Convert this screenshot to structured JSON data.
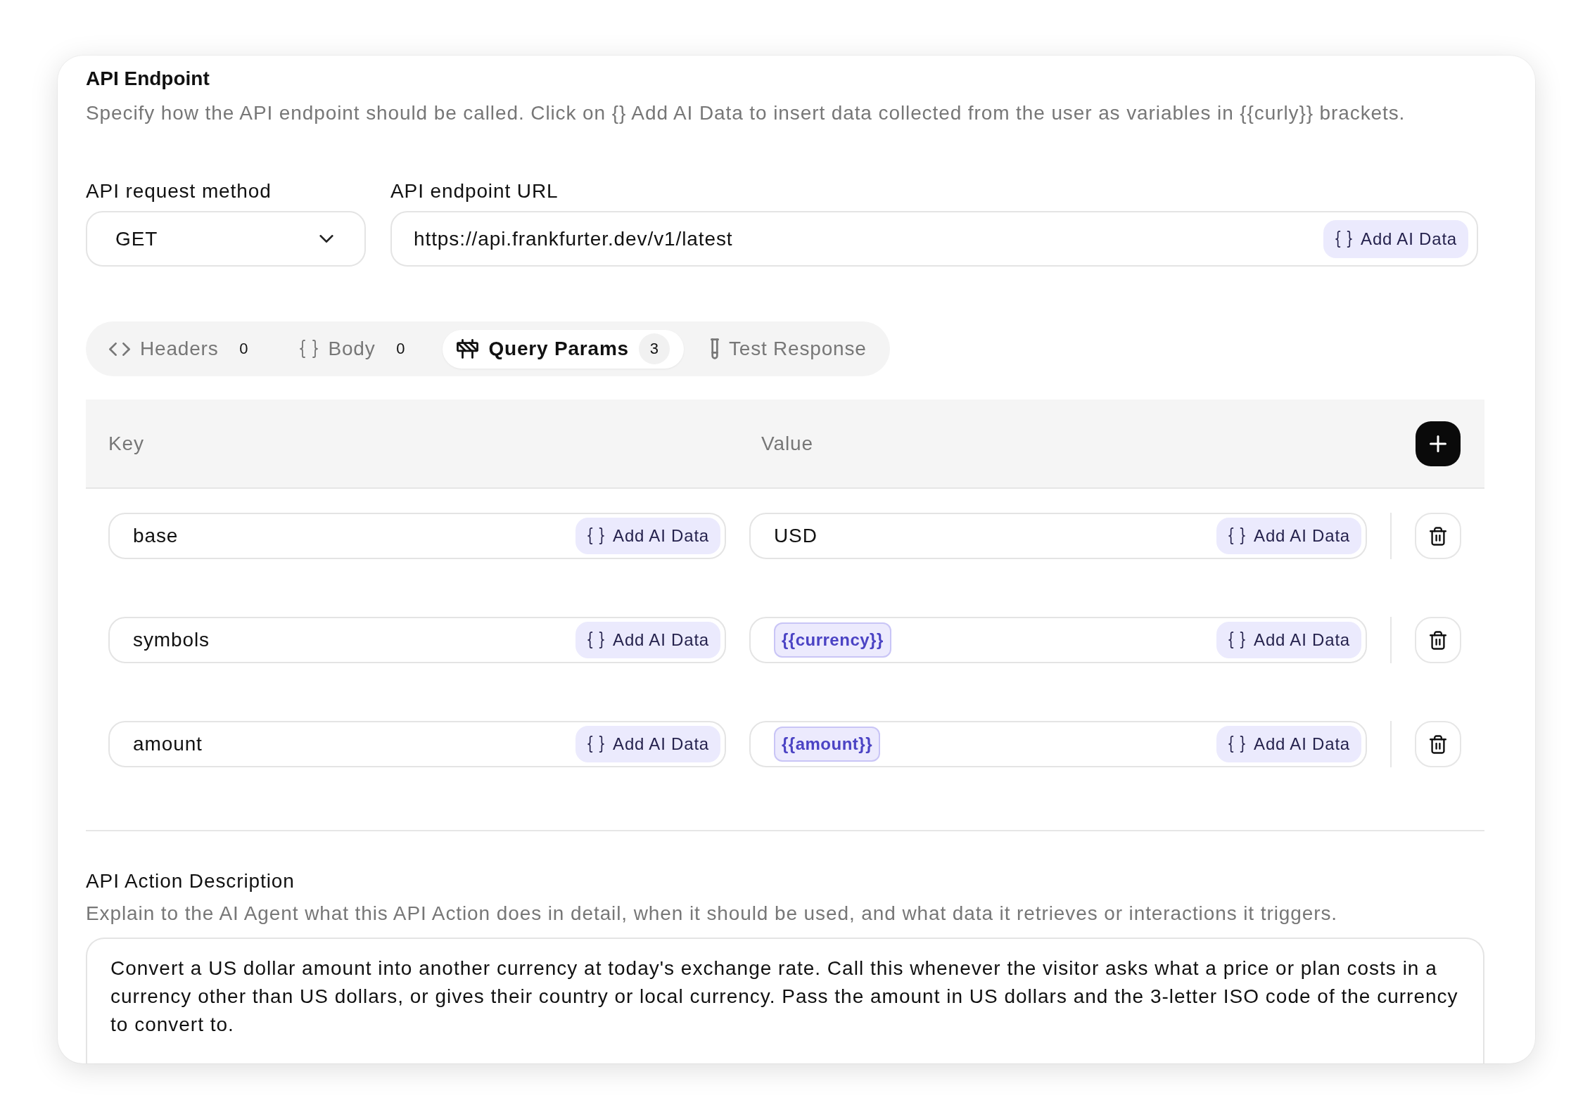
{
  "section": {
    "title": "API Endpoint",
    "description": "Specify how the API endpoint should be called. Click on {} Add AI Data to insert data collected from the user as variables in {{curly}} brackets."
  },
  "method": {
    "label": "API request method",
    "value": "GET"
  },
  "url": {
    "label": "API endpoint URL",
    "value": "https://api.frankfurter.dev/v1/latest",
    "button": "Add AI Data"
  },
  "tabs": [
    {
      "kind": "headers",
      "label": "Headers",
      "count": "0",
      "selected": false
    },
    {
      "kind": "body",
      "label": "Body",
      "count": "0",
      "selected": false
    },
    {
      "kind": "query",
      "label": "Query Params",
      "count": "3",
      "selected": true
    },
    {
      "kind": "test",
      "label": "Test Response",
      "selected": false
    }
  ],
  "params_table": {
    "columns": [
      "Key",
      "Value"
    ],
    "rows": [
      {
        "key": "base",
        "key_button": "Add AI Data",
        "value": {
          "kind": "text",
          "text": "USD"
        },
        "value_button": "Add AI Data"
      },
      {
        "key": "symbols",
        "key_button": "Add AI Data",
        "value": {
          "kind": "variable",
          "text": "{{currency}}"
        },
        "value_button": "Add AI Data"
      },
      {
        "key": "amount",
        "key_button": "Add AI Data",
        "value": {
          "kind": "variable",
          "text": "{{amount}}"
        },
        "value_button": "Add AI Data"
      }
    ]
  },
  "action_description": {
    "title": "API Action Description",
    "hint": "Explain to the AI Agent what this API Action does in detail, when it should be used, and what data it retrieves or interactions it triggers.",
    "value": "Convert a US dollar amount into another currency at today's exchange rate. Call this whenever the visitor asks what a price or plan costs in a currency other than US dollars, or gives their country or local currency. Pass the amount in US dollars and the 3-letter ISO code of the currency to convert to."
  }
}
